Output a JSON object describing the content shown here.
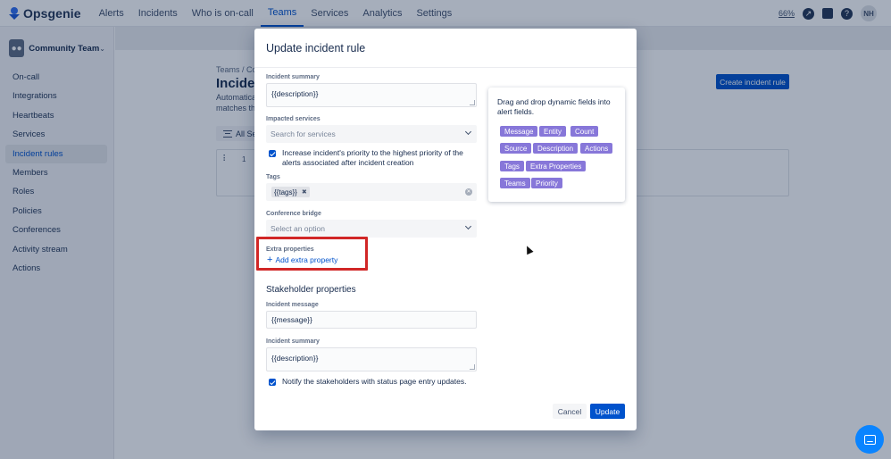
{
  "topnav": {
    "logo": "Opsgenie",
    "items": [
      "Alerts",
      "Incidents",
      "Who is on-call",
      "Teams",
      "Services",
      "Analytics",
      "Settings"
    ],
    "active_index": 3,
    "zoom": "66%",
    "avatar": "NH"
  },
  "sidebar": {
    "team_name": "Community Team",
    "items": [
      "On-call",
      "Integrations",
      "Heartbeats",
      "Services",
      "Incident rules",
      "Members",
      "Roles",
      "Policies",
      "Conferences",
      "Activity stream",
      "Actions"
    ],
    "active_index": 4
  },
  "page": {
    "breadcrumb": "Teams  / Com",
    "title": "Incident",
    "desc_line1": "Automaticall",
    "desc_line2": "matches the",
    "create_button": "Create incident rule",
    "filter_label": "All Ser",
    "rule_number": "1"
  },
  "modal": {
    "title": "Update incident rule",
    "incident_summary_label": "Incident summary",
    "incident_summary_value": "{{description}}",
    "impacted_services_label": "Impacted services",
    "impacted_services_placeholder": "Search for services",
    "increase_priority_text": "Increase incident's priority to the highest priority of the alerts associated after incident creation",
    "increase_priority_checked": true,
    "tags_label": "Tags",
    "tag_value": "{{tags}}",
    "conference_bridge_label": "Conference bridge",
    "conference_bridge_placeholder": "Select an option",
    "extra_properties_label": "Extra properties",
    "add_extra_property": "Add extra property",
    "stakeholder_title": "Stakeholder properties",
    "incident_message_label": "Incident message",
    "incident_message_value": "{{message}}",
    "stakeholder_summary_label": "Incident summary",
    "stakeholder_summary_value": "{{description}}",
    "notify_text": "Notify the stakeholders with status page entry updates.",
    "notify_checked": true,
    "cancel_button": "Cancel",
    "update_button": "Update"
  },
  "dynamic_fields": {
    "hint": "Drag and drop dynamic fields into alert fields.",
    "chips": [
      "Message",
      "Entity",
      "Count",
      "Source",
      "Description",
      "Actions",
      "Tags",
      "Extra Properties",
      "Teams",
      "Priority"
    ]
  },
  "colors": {
    "primary": "#0052cc",
    "chip": "#8777d9",
    "highlight": "#d12727",
    "chat": "#0a84ff"
  }
}
